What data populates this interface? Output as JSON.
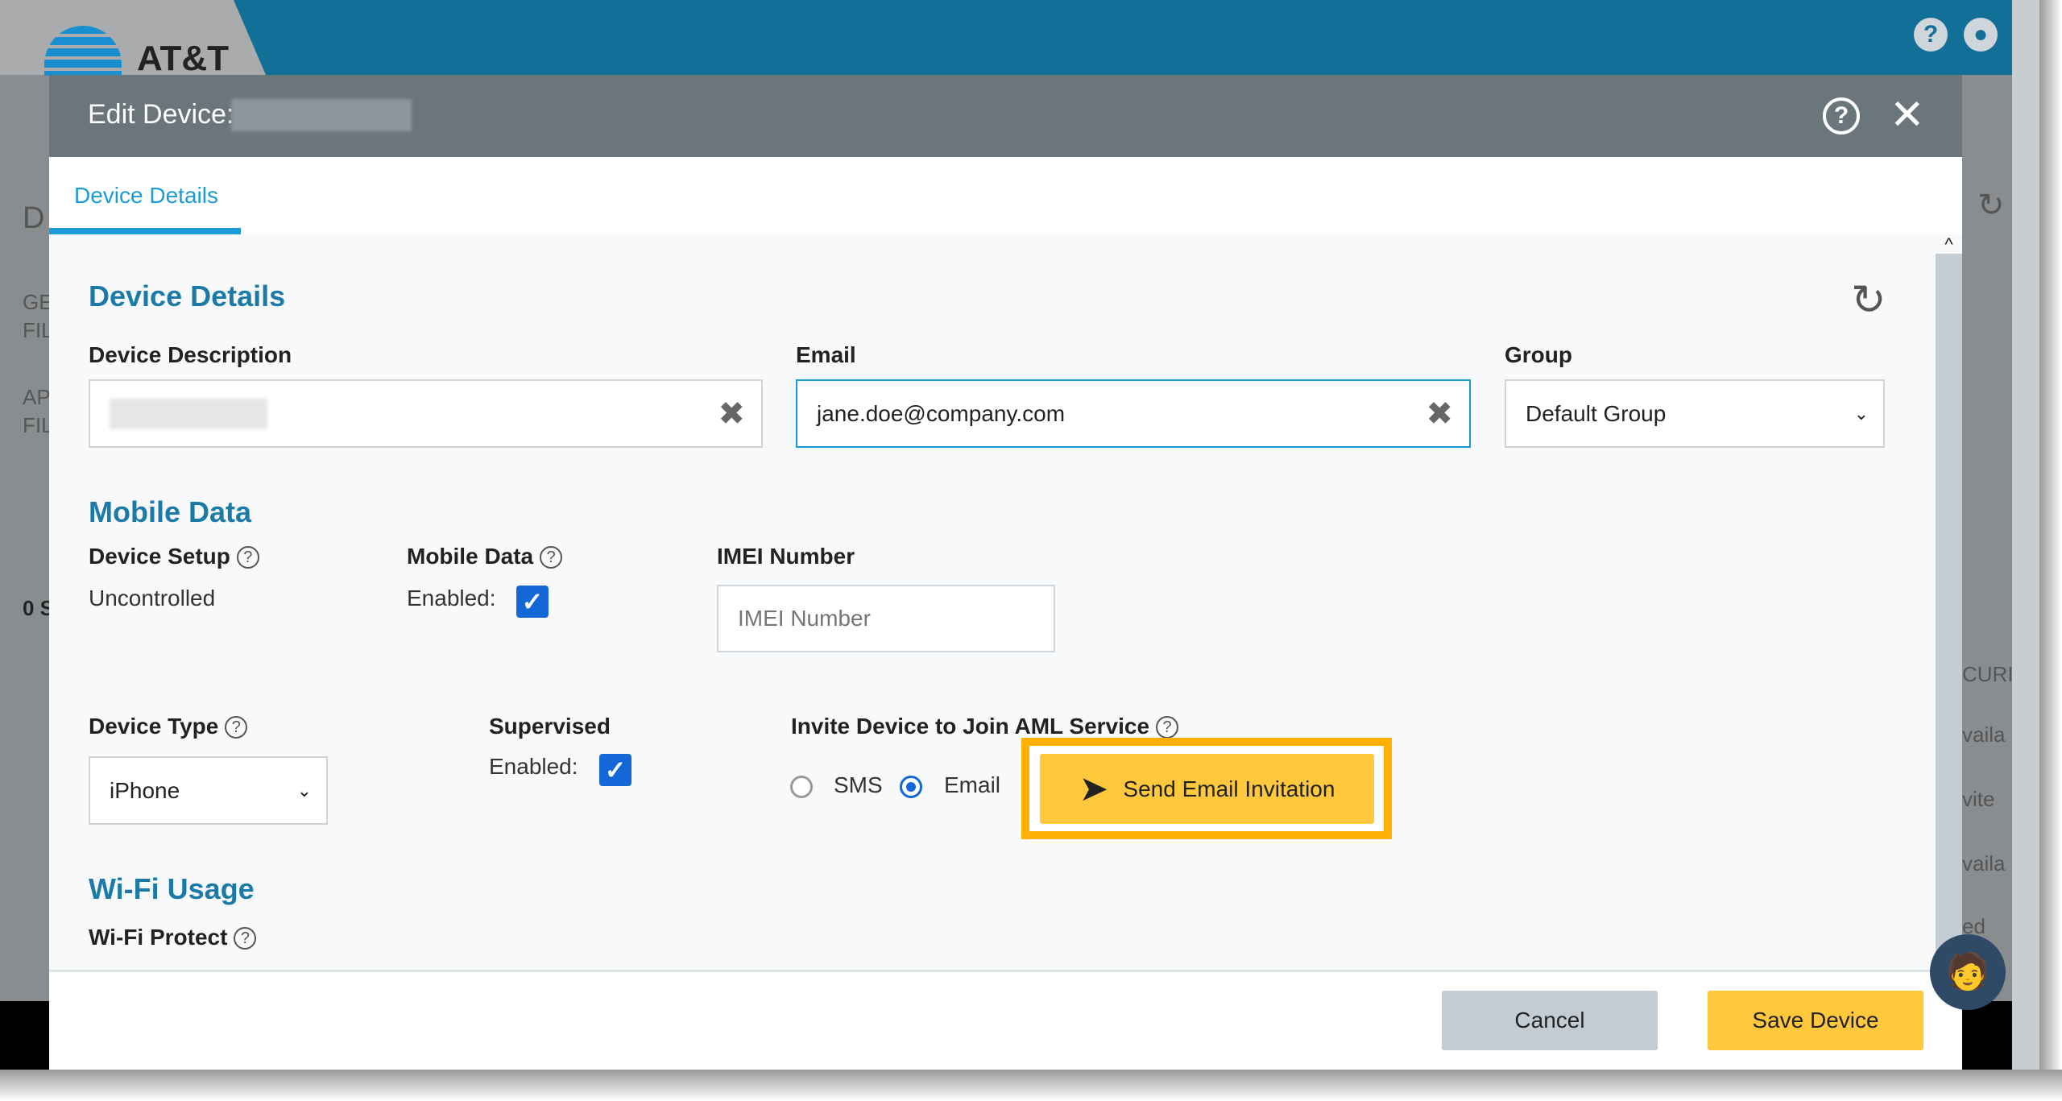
{
  "app": {
    "brand": "AT&T",
    "help_icon": "question-circle-icon",
    "user_icon": "user-circle-icon"
  },
  "background": {
    "heading": "D",
    "filters": [
      "GE",
      "FIL",
      "AP",
      "FIL"
    ],
    "count": "0 S",
    "col": "CURIT",
    "cells": [
      "vaila",
      "vite",
      "vaila",
      "ed"
    ]
  },
  "modal": {
    "title": "Edit Device:",
    "tab": "Device Details",
    "section_device": "Device Details",
    "device_description_label": "Device Description",
    "email_label": "Email",
    "email_value": "jane.doe@company.com",
    "group_label": "Group",
    "group_value": "Default Group",
    "section_mobile": "Mobile Data",
    "device_setup_label": "Device Setup",
    "device_setup_value": "Uncontrolled",
    "mobile_data_label": "Mobile Data",
    "enabled_label": "Enabled:",
    "mobile_data_enabled": true,
    "imei_label": "IMEI Number",
    "imei_placeholder": "IMEI Number",
    "device_type_label": "Device Type",
    "device_type_value": "iPhone",
    "supervised_label": "Supervised",
    "supervised_enabled": true,
    "invite_label": "Invite Device to Join AML Service",
    "sms_label": "SMS",
    "email_radio_label": "Email",
    "invite_selected": "Email",
    "send_button": "Send Email Invitation",
    "section_wifi": "Wi-Fi Usage",
    "wifi_protect_label": "Wi-Fi Protect",
    "cancel": "Cancel",
    "save": "Save Device"
  },
  "colors": {
    "accent": "#1a9bd7",
    "heading": "#1c7aa8",
    "primary_button": "#ffc83d",
    "highlight": "#ffb000",
    "header": "#6b767c",
    "checkbox": "#1467d6"
  }
}
